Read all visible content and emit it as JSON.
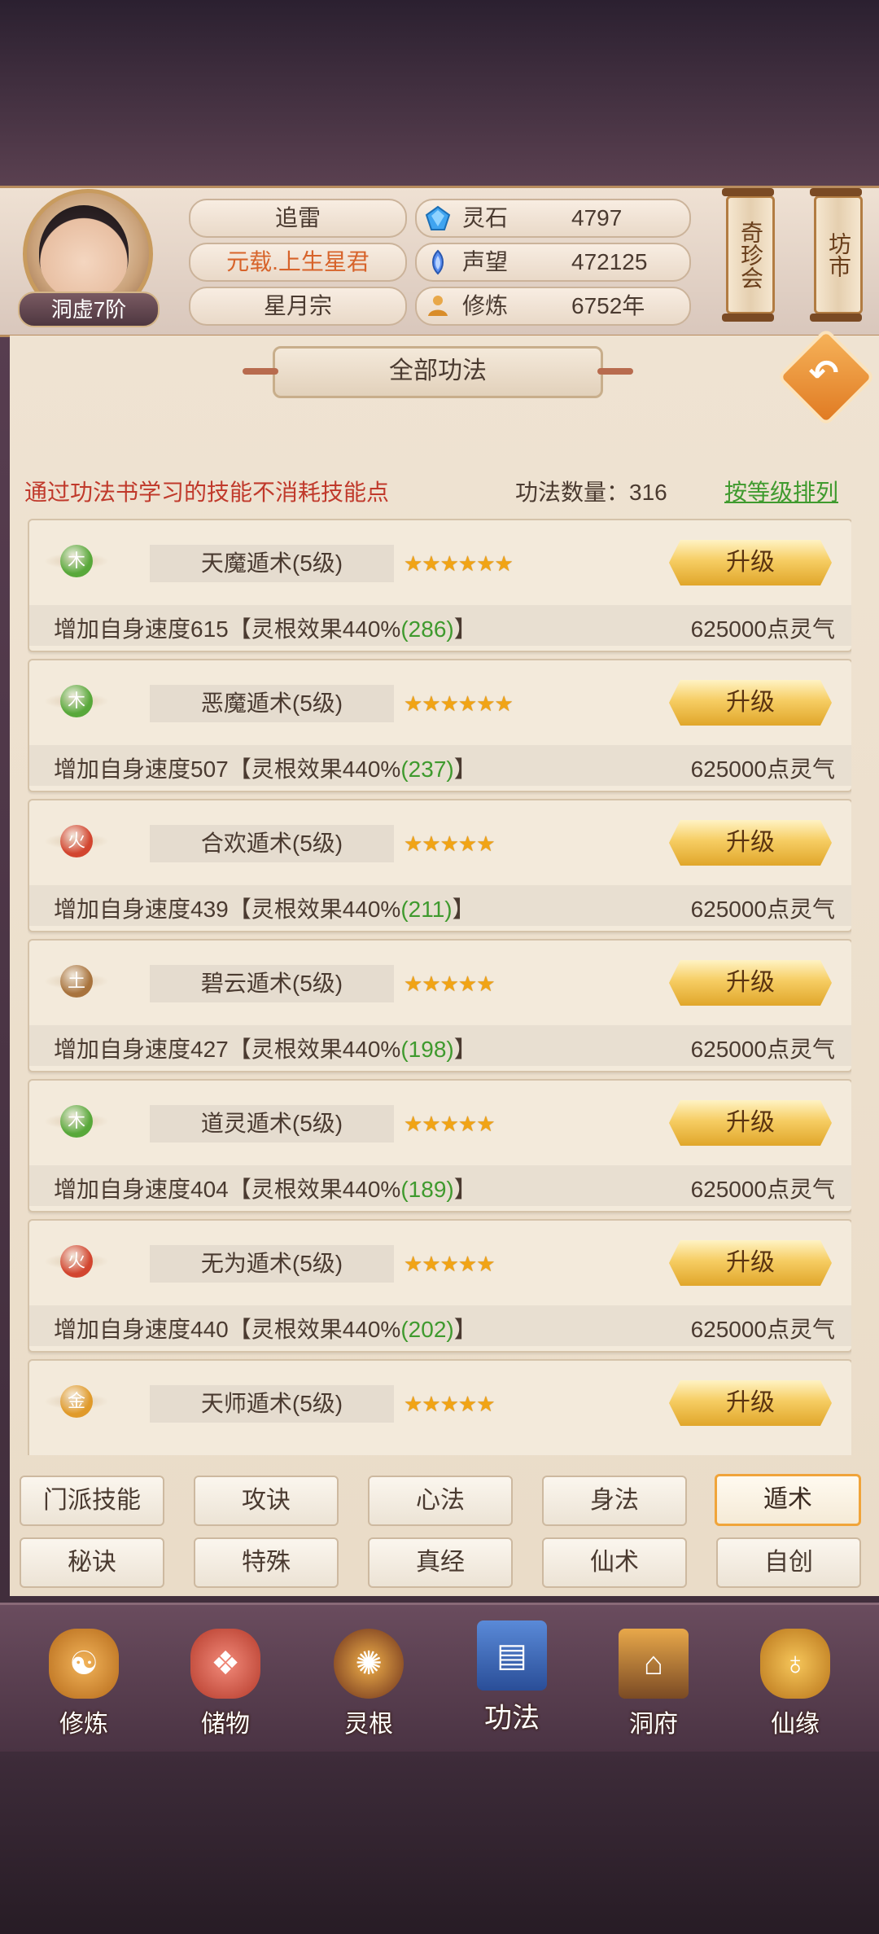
{
  "header": {
    "character_name": "追雷",
    "title": "元载.上生星君",
    "sect": "星月宗",
    "realm": "洞虚7阶",
    "resources": [
      {
        "name": "灵石",
        "value": "4797",
        "icon": "spirit-stone-icon"
      },
      {
        "name": "声望",
        "value": "472125",
        "icon": "prestige-icon"
      },
      {
        "name": "修炼",
        "value": "6752年",
        "icon": "cultivation-icon"
      }
    ],
    "scroll_buttons": [
      "奇珍会",
      "坊市"
    ]
  },
  "panel": {
    "title": "全部功法",
    "notice": "通过功法书学习的技能不消耗技能点",
    "count_label": "功法数量：316",
    "sort_link": "按等级排列"
  },
  "skills": [
    {
      "element": "木",
      "name": "天魔遁术(5级)",
      "stars": "★★★★★★",
      "button": "升级",
      "desc": "增加自身速度615【灵根效果440%",
      "bonus": "(286)",
      "desc_end": "】",
      "cost": "625000点灵气"
    },
    {
      "element": "木",
      "name": "恶魔遁术(5级)",
      "stars": "★★★★★★",
      "button": "升级",
      "desc": "增加自身速度507【灵根效果440%",
      "bonus": "(237)",
      "desc_end": "】",
      "cost": "625000点灵气"
    },
    {
      "element": "火",
      "name": "合欢遁术(5级)",
      "stars": "★★★★★",
      "button": "升级",
      "desc": "增加自身速度439【灵根效果440%",
      "bonus": "(211)",
      "desc_end": "】",
      "cost": "625000点灵气"
    },
    {
      "element": "土",
      "name": "碧云遁术(5级)",
      "stars": "★★★★★",
      "button": "升级",
      "desc": "增加自身速度427【灵根效果440%",
      "bonus": "(198)",
      "desc_end": "】",
      "cost": "625000点灵气"
    },
    {
      "element": "木",
      "name": "道灵遁术(5级)",
      "stars": "★★★★★",
      "button": "升级",
      "desc": "增加自身速度404【灵根效果440%",
      "bonus": "(189)",
      "desc_end": "】",
      "cost": "625000点灵气"
    },
    {
      "element": "火",
      "name": "无为遁术(5级)",
      "stars": "★★★★★",
      "button": "升级",
      "desc": "增加自身速度440【灵根效果440%",
      "bonus": "(202)",
      "desc_end": "】",
      "cost": "625000点灵气"
    },
    {
      "element": "金",
      "name": "天师遁术(5级)",
      "stars": "★★★★★",
      "button": "升级",
      "desc": "",
      "bonus": "",
      "desc_end": "",
      "cost": ""
    }
  ],
  "element_colors": {
    "木": "#58a83a",
    "火": "#d2452f",
    "土": "#a8733d",
    "金": "#e09a2a"
  },
  "tabs": {
    "row1": [
      "门派技能",
      "攻诀",
      "心法",
      "身法",
      "遁术"
    ],
    "row2": [
      "秘诀",
      "特殊",
      "真经",
      "仙术",
      "自创"
    ],
    "active": "遁术"
  },
  "nav": [
    {
      "label": "修炼",
      "icon": "cultivation-monk-icon"
    },
    {
      "label": "储物",
      "icon": "storage-bag-icon"
    },
    {
      "label": "灵根",
      "icon": "spirit-root-icon"
    },
    {
      "label": "功法",
      "icon": "skill-book-icon",
      "active": true
    },
    {
      "label": "洞府",
      "icon": "cave-mansion-icon"
    },
    {
      "label": "仙缘",
      "icon": "immortal-fate-gourd-icon"
    }
  ]
}
